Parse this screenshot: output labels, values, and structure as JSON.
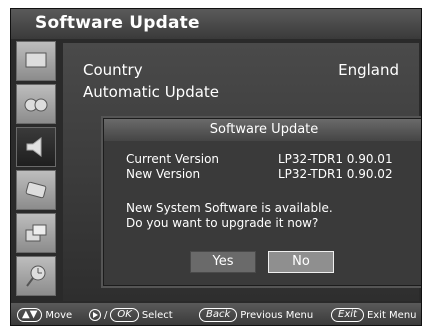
{
  "header": {
    "title": "Software Update"
  },
  "settings": [
    {
      "label": "Country",
      "value": "England"
    },
    {
      "label": "Automatic Update",
      "value": ""
    }
  ],
  "dialog": {
    "title": "Software Update",
    "current_label": "Current Version",
    "current_value": "LP32-TDR1 0.90.01",
    "new_label": "New Version",
    "new_value": "LP32-TDR1 0.90.02",
    "message_line1": "New System Software is available.",
    "message_line2": "Do you want to upgrade it now?",
    "yes_label": "Yes",
    "no_label": "No"
  },
  "footer": {
    "move_label": "Move",
    "ok_key": "OK",
    "select_label": "Select",
    "back_key": "Back",
    "previous_label": "Previous Menu",
    "exit_key": "Exit",
    "exit_label": "Exit Menu"
  },
  "sidebar_icons": [
    "screen-icon",
    "glasses-icon",
    "speaker-icon",
    "remote-icon",
    "windows-icon",
    "clock-icon"
  ]
}
